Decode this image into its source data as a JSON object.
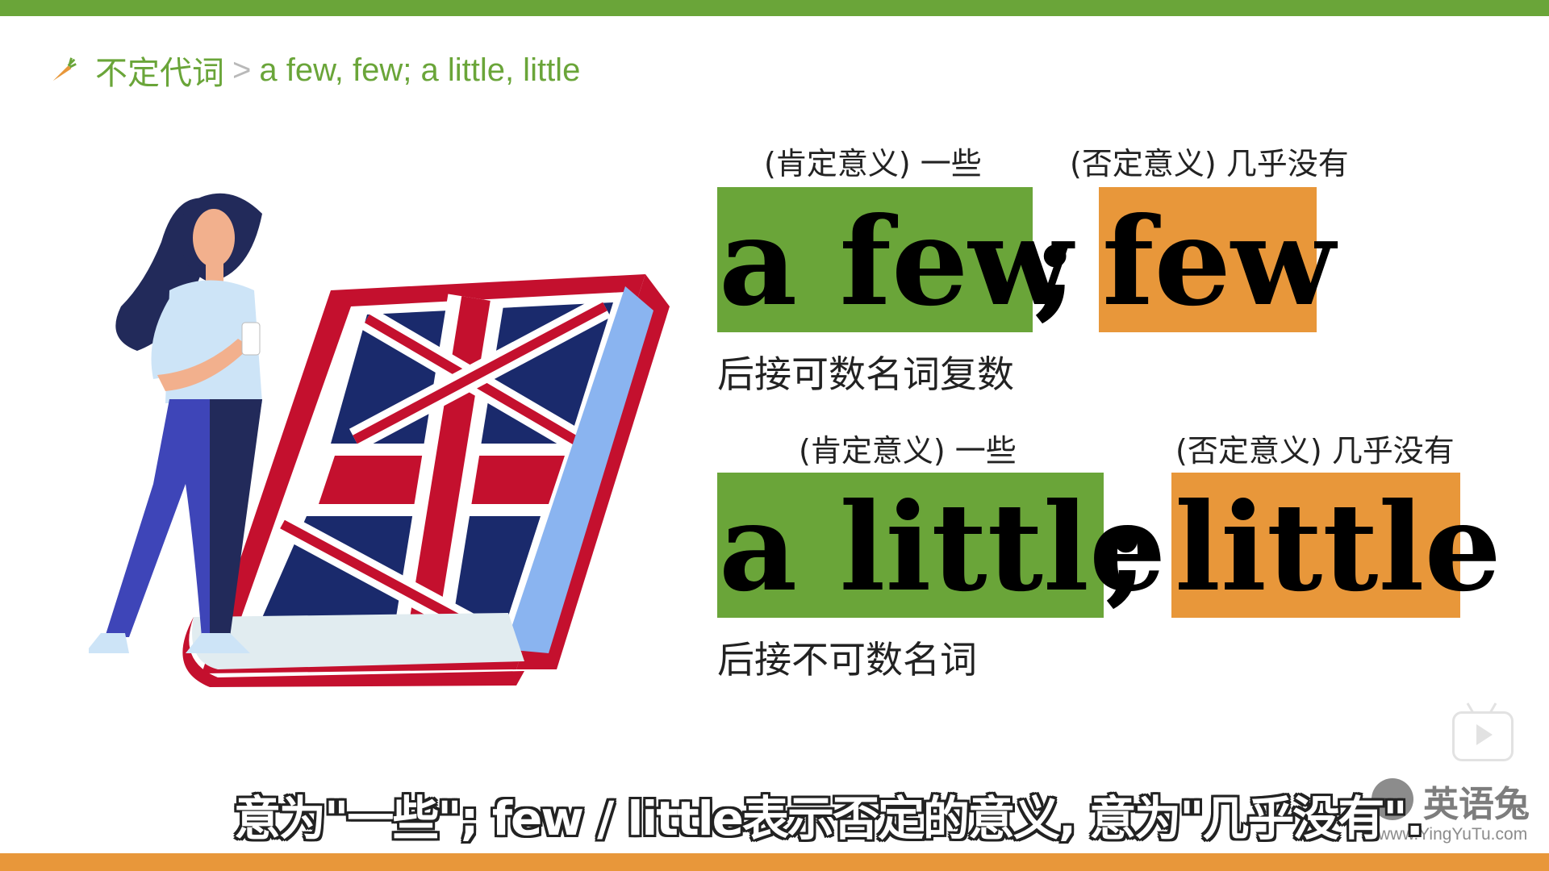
{
  "colors": {
    "green": "#6aa539",
    "orange": "#e8973a"
  },
  "breadcrumb": {
    "icon": "carrot-icon",
    "section": "不定代词",
    "separator": ">",
    "topic": "a few, few; a little, little"
  },
  "rows": [
    {
      "positive_note": "(肯定意义) 一些",
      "negative_note": "(否定意义) 几乎没有",
      "positive_word": "a few",
      "separator": ";",
      "negative_word": "few",
      "description": "后接可数名词复数"
    },
    {
      "positive_note": "(肯定意义) 一些",
      "negative_note": "(否定意义) 几乎没有",
      "positive_word": "a little",
      "separator": ";",
      "negative_word": "little",
      "description": "后接不可数名词"
    }
  ],
  "subtitle": "意为\"一些\"; few / little表示否定的意义, 意为\"几乎没有\".",
  "watermark": {
    "brand": "英语兔",
    "url": "www.YingYuTu.com",
    "icon": "rabbit-logo-icon"
  },
  "player": {
    "icon": "play-icon"
  }
}
